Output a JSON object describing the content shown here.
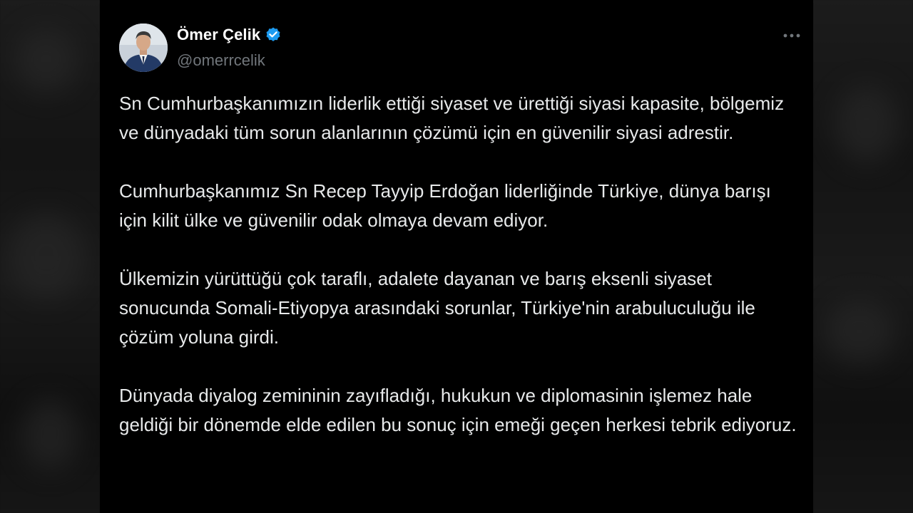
{
  "tweet": {
    "author_name": "Ömer Çelik",
    "author_handle": "@omerrcelik",
    "verified": true,
    "verified_color": "#1d9bf0",
    "more_icon": "more-horizontal-icon",
    "paragraphs": [
      "Sn Cumhurbaşkanımızın liderlik ettiği siyaset ve ürettiği siyasi kapasite, bölgemiz ve dünyadaki tüm sorun alanlarının çözümü için en güvenilir siyasi adrestir.",
      "Cumhurbaşkanımız Sn Recep Tayyip Erdoğan liderliğinde Türkiye, dünya barışı için kilit ülke ve güvenilir odak olmaya devam ediyor.",
      "Ülkemizin yürüttüğü çok taraflı, adalete dayanan ve barış eksenli siyaset sonucunda Somali-Etiyopya arasındaki sorunlar, Türkiye'nin arabuluculuğu ile çözüm yoluna girdi.",
      "Dünyada diyalog zemininin zayıfladığı, hukukun ve diplomasinin işlemez hale geldiği bir dönemde elde edilen bu sonuç için emeği geçen herkesi tebrik ediyoruz."
    ]
  },
  "colors": {
    "background": "#000000",
    "text": "#e7e9ea",
    "secondary_text": "#71767b"
  }
}
